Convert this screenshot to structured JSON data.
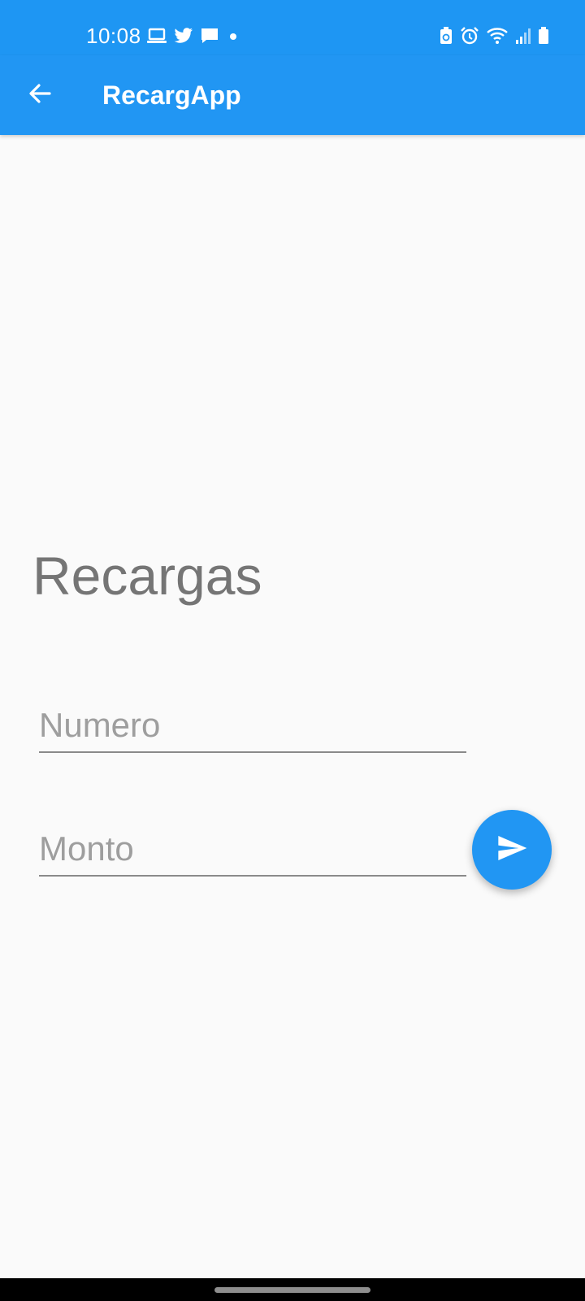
{
  "status_bar": {
    "time": "10:08",
    "left_icons": [
      "laptop-icon",
      "twitter-icon",
      "message-icon",
      "dot-icon"
    ],
    "right_icons": [
      "battery-saver-icon",
      "alarm-icon",
      "wifi-icon",
      "signal-icon",
      "battery-icon"
    ],
    "background_color": "#1e96f3"
  },
  "app_bar": {
    "title": "RecargApp",
    "back_icon": "arrow-back-icon",
    "background_color": "#2196f3"
  },
  "main": {
    "heading": "Recargas",
    "numero_field": {
      "placeholder": "Numero",
      "value": ""
    },
    "monto_field": {
      "placeholder": "Monto",
      "value": ""
    },
    "send_button": {
      "icon": "send-icon",
      "color": "#2196f3"
    }
  },
  "colors": {
    "accent": "#2196f3",
    "heading_text": "#757575",
    "placeholder_text": "#9e9e9e",
    "background": "#fafafa"
  }
}
